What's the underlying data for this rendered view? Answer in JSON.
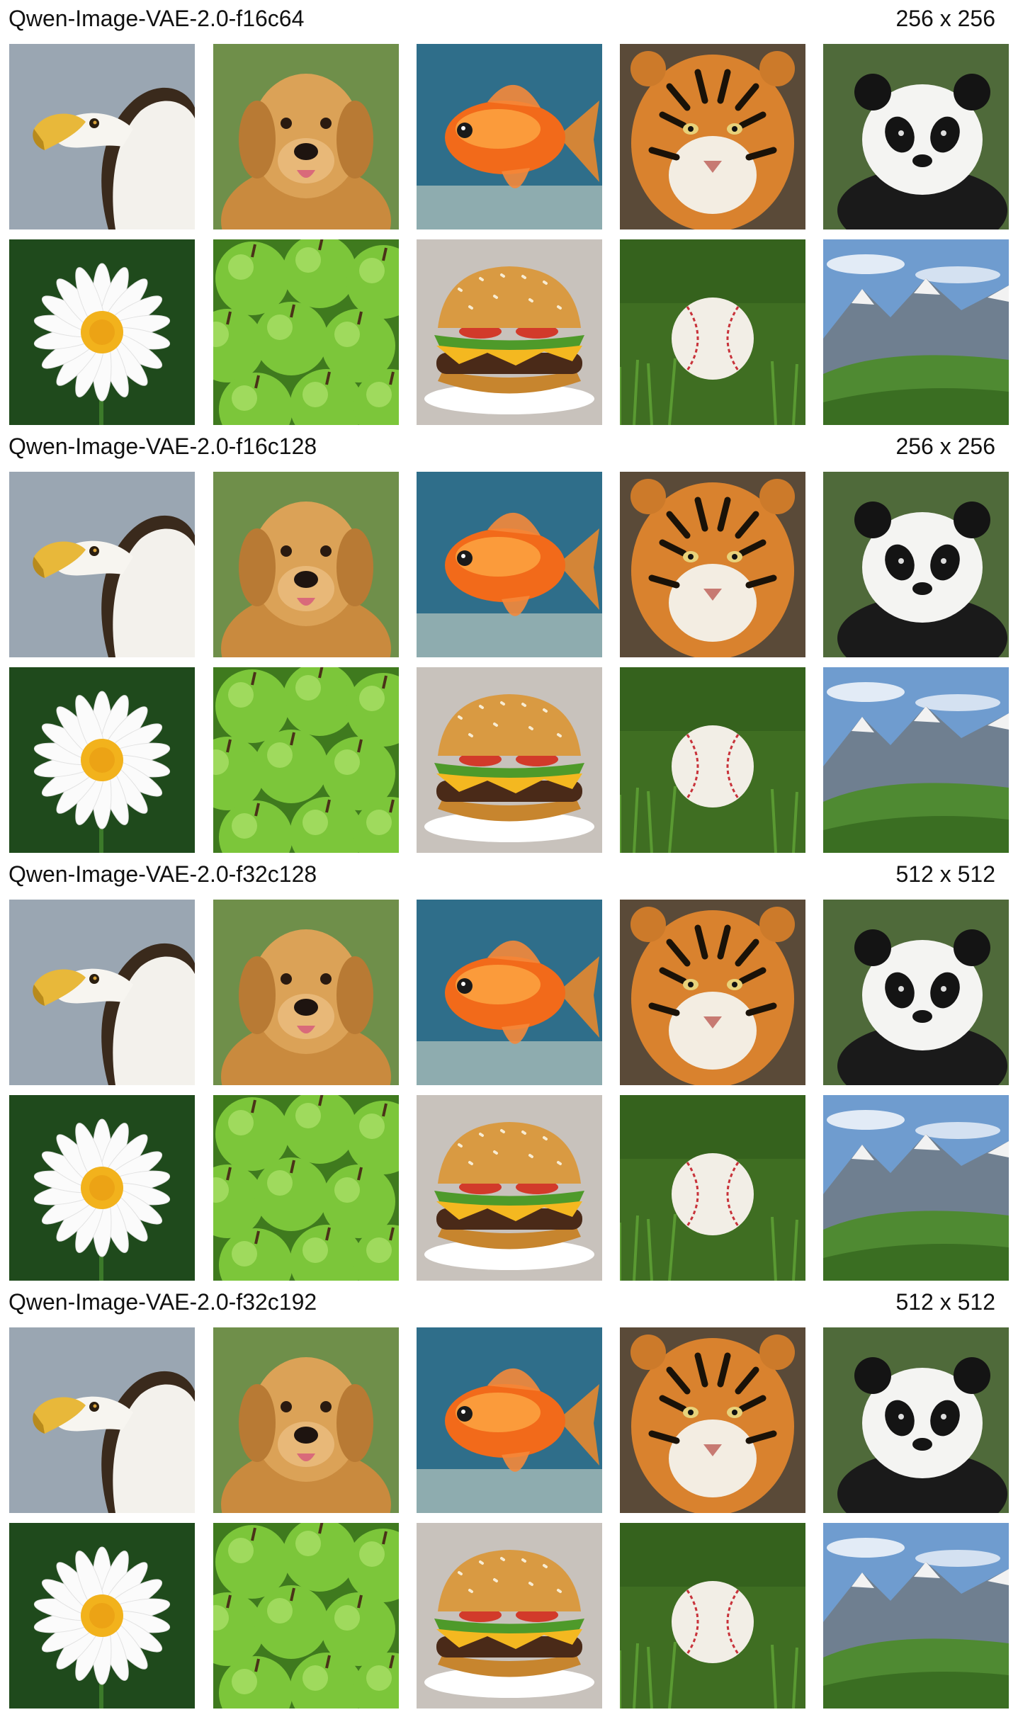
{
  "sections": [
    {
      "model": "Qwen-Image-VAE-2.0-f16c64",
      "resolution": "256 x 256"
    },
    {
      "model": "Qwen-Image-VAE-2.0-f16c128",
      "resolution": "256 x 256"
    },
    {
      "model": "Qwen-Image-VAE-2.0-f32c128",
      "resolution": "512 x 512"
    },
    {
      "model": "Qwen-Image-VAE-2.0-f32c192",
      "resolution": "512 x 512"
    }
  ],
  "subjects": [
    {
      "icon": "eagle-image",
      "bg": "#9aa6b2"
    },
    {
      "icon": "golden-retriever-image",
      "bg": "#6f8f4a"
    },
    {
      "icon": "goldfish-image",
      "bg": "#2f6e8a"
    },
    {
      "icon": "tiger-image",
      "bg": "#5a4a38"
    },
    {
      "icon": "panda-image",
      "bg": "#4f6a3a"
    },
    {
      "icon": "daisy-image",
      "bg": "#1f4a1c"
    },
    {
      "icon": "green-apples-image",
      "bg": "#3f7a1e"
    },
    {
      "icon": "cheeseburger-image",
      "bg": "#c8c2bc"
    },
    {
      "icon": "baseball-image",
      "bg": "#3f6e22"
    },
    {
      "icon": "mountain-landscape-image",
      "bg": "#6f9ccf"
    }
  ]
}
